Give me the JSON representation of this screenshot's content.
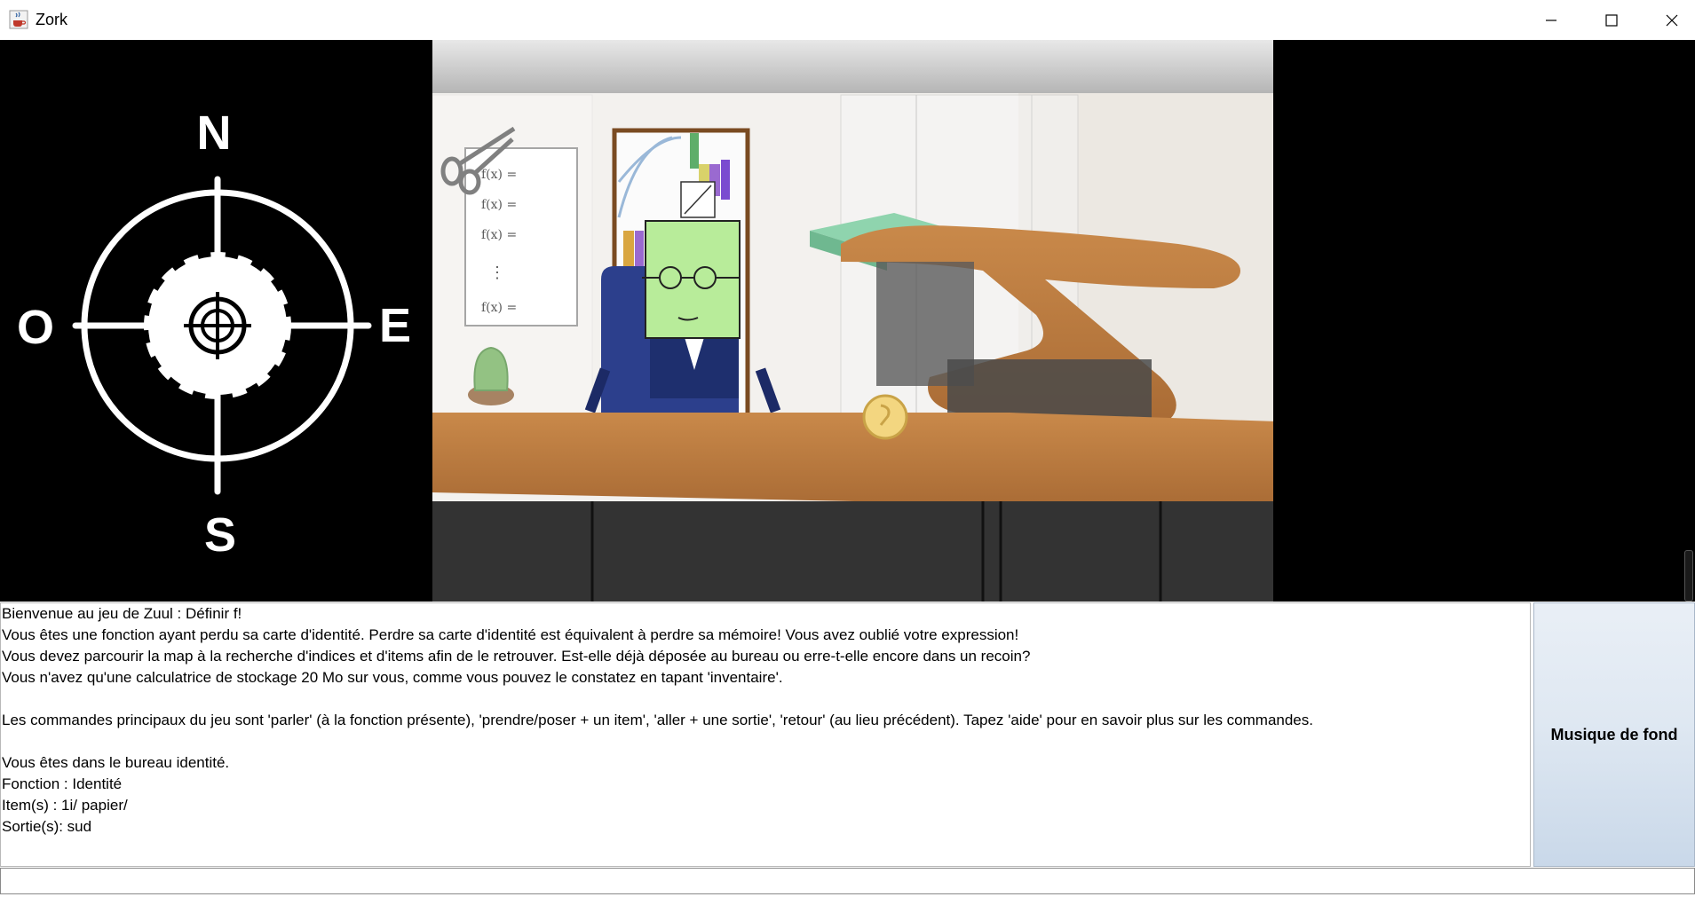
{
  "window": {
    "title": "Zork",
    "icon": "java-coffee-cup-icon",
    "controls": [
      "minimize-icon",
      "maximize-icon",
      "close-icon"
    ]
  },
  "compass": {
    "north": "N",
    "south": "S",
    "east": "E",
    "west": "O",
    "icon": "gear-compass-icon"
  },
  "scene": {
    "whiteboard_lines": [
      "f(x) =",
      "f(x) =",
      "f(x) =",
      "⋮",
      "f(x) ="
    ]
  },
  "log": {
    "lines": [
      "Bienvenue au jeu de Zuul : Définir f!",
      "Vous êtes une fonction ayant perdu sa carte d'identité. Perdre sa carte d'identité est équivalent à perdre sa mémoire! Vous avez oublié votre expression!",
      "Vous devez parcourir la map à la recherche d'indices et d'items afin de le retrouver. Est-elle déjà déposée au bureau ou erre-t-elle encore dans un recoin?",
      "Vous n'avez qu'une calculatrice de stockage 20 Mo sur vous, comme vous pouvez le constatez en tapant 'inventaire'.",
      "",
      "Les commandes principaux du jeu sont 'parler' (à la fonction présente), 'prendre/poser + un item', 'aller + une sortie', 'retour' (au lieu précédent). Tapez 'aide' pour en savoir plus sur les commandes.",
      "",
      "Vous êtes dans le bureau identité.",
      "Fonction : Identité",
      "Item(s) : 1i/ papier/",
      "Sortie(s): sud"
    ]
  },
  "music_button": {
    "label": "Musique de fond"
  },
  "command_input": {
    "value": ""
  }
}
